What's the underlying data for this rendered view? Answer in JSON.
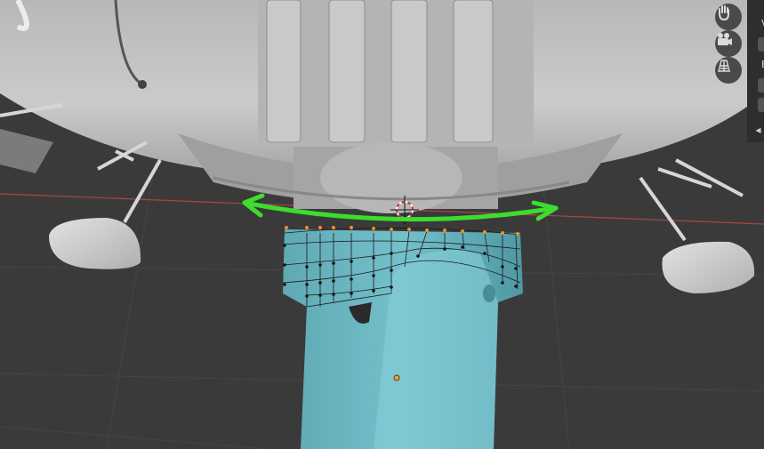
{
  "viewport": {
    "background": "#3a3a3a",
    "grid_color": "#444444",
    "x_axis_color": "#a94646",
    "model_color": "#c4c4c4",
    "selected_mesh_color": "#6fbac5",
    "annotation_color": "#3ddc2e",
    "vertex_color": "#141414",
    "selected_vertex_color": "#ff8c1a"
  },
  "navigation": {
    "pan_tool": {
      "icon": "hand-icon"
    },
    "camera_view": {
      "icon": "camera-icon"
    },
    "perspective_toggle": {
      "icon": "grid-icon"
    }
  },
  "side_panel": {
    "labels": [
      "V",
      "E"
    ]
  }
}
